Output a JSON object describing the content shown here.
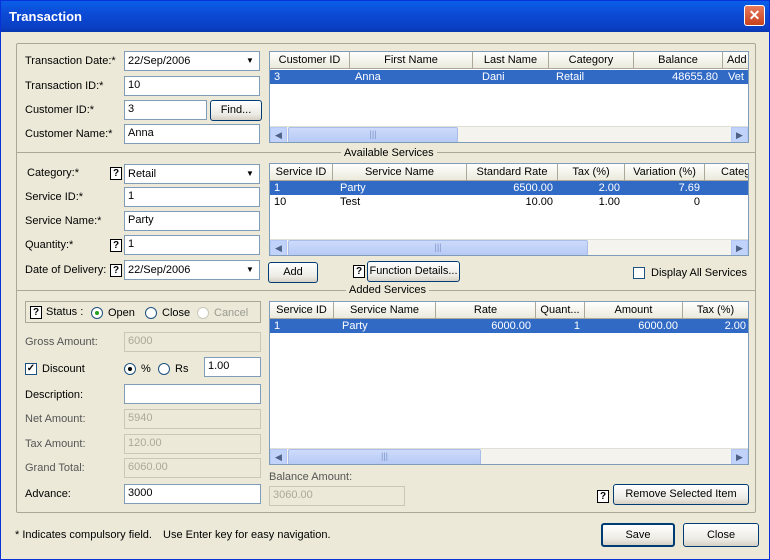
{
  "window": {
    "title": "Transaction",
    "close_glyph": "✕"
  },
  "customer_section": {
    "transaction_date_label": "Transaction Date:*",
    "transaction_date_value": "22/Sep/2006",
    "transaction_id_label": "Transaction ID:*",
    "transaction_id_value": "10",
    "customer_id_label": "Customer ID:*",
    "customer_id_value": "3",
    "find_button": "Find...",
    "customer_name_label": "Customer Name:*",
    "customer_name_value": "Anna"
  },
  "customer_grid": {
    "columns": [
      "Customer ID",
      "First Name",
      "Last Name",
      "Category",
      "Balance",
      "Add"
    ],
    "rows": [
      {
        "customer_id": "3",
        "first_name": "Anna",
        "last_name": "Dani",
        "category": "Retail",
        "balance": "48655.80",
        "address": "Vet"
      }
    ]
  },
  "service_section": {
    "category_label": "Category:*",
    "category_value": "Retail",
    "service_id_label": "Service ID:*",
    "service_id_value": "1",
    "service_name_label": "Service Name:*",
    "service_name_value": "Party",
    "quantity_label": "Quantity:*",
    "quantity_value": "1",
    "delivery_label": "Date of Delivery:",
    "delivery_value": "22/Sep/2006",
    "add_button": "Add",
    "function_details_button": "Function Details...",
    "display_all_label": "Display All Services",
    "help_glyph": "?"
  },
  "available_services": {
    "legend": "Available Services",
    "columns": [
      "Service ID",
      "Service Name",
      "Standard Rate",
      "Tax (%)",
      "Variation (%)",
      "Categ"
    ],
    "rows": [
      {
        "id": "1",
        "name": "Party",
        "rate": "6500.00",
        "tax": "2.00",
        "variation": "7.69"
      },
      {
        "id": "10",
        "name": "Test",
        "rate": "10.00",
        "tax": "1.00",
        "variation": "0"
      }
    ]
  },
  "added_services": {
    "legend": "Added Services",
    "columns": [
      "Service ID",
      "Service Name",
      "Rate",
      "Quant...",
      "Amount",
      "Tax (%)"
    ],
    "rows": [
      {
        "id": "1",
        "name": "Party",
        "rate": "6000.00",
        "qty": "1",
        "amount": "6000.00",
        "tax": "2.00"
      }
    ],
    "balance_label": "Balance Amount:",
    "balance_value": "3060.00",
    "remove_button": "Remove Selected Item"
  },
  "totals": {
    "status_label": "Status :",
    "status_open": "Open",
    "status_close": "Close",
    "status_cancel": "Cancel",
    "gross_label": "Gross Amount:",
    "gross_value": "6000",
    "discount_label": "Discount",
    "percent_label": "%",
    "rs_label": "Rs",
    "discount_value": "1.00",
    "description_label": "Description:",
    "description_value": "",
    "net_label": "Net Amount:",
    "net_value": "5940",
    "tax_label": "Tax Amount:",
    "tax_value": "120.00",
    "grand_label": "Grand Total:",
    "grand_value": "6060.00",
    "advance_label": "Advance:",
    "advance_value": "3000"
  },
  "footer": {
    "note": "* Indicates compulsory field.",
    "hint": "Use Enter key for easy navigation.",
    "save_button": "Save",
    "close_button": "Close"
  },
  "icons": {
    "dropdown": "▼",
    "scroll_left": "◀",
    "scroll_right": "▶",
    "grip": "|||",
    "check": "✓"
  },
  "colors": {
    "selection": "#316ac5",
    "titlebar": "#0a5fe8",
    "face": "#ece9d8"
  }
}
